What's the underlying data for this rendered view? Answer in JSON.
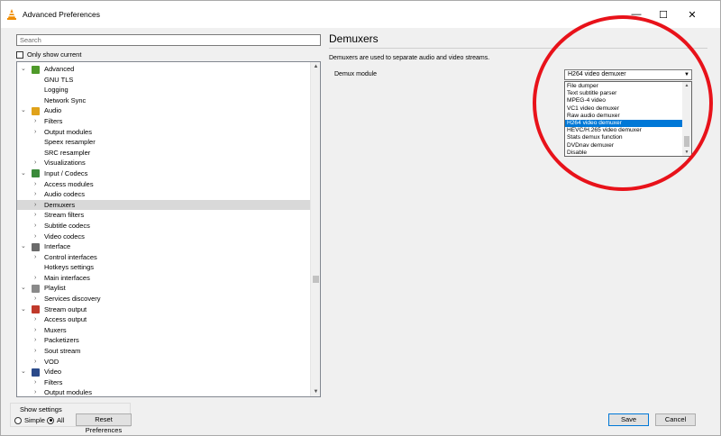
{
  "window": {
    "title": "Advanced Preferences",
    "controls": {
      "minimize": "—",
      "maximize": "☐",
      "close": "✕"
    }
  },
  "left": {
    "search_placeholder": "Search",
    "only_show_current": "Only show current",
    "tree": [
      {
        "label": "Advanced",
        "level": 0,
        "expanded": true,
        "icon": "advanced-icon",
        "color": "#4f9a2a"
      },
      {
        "label": "GNU TLS",
        "level": 1
      },
      {
        "label": "Logging",
        "level": 1
      },
      {
        "label": "Network Sync",
        "level": 1
      },
      {
        "label": "Audio",
        "level": 0,
        "expanded": true,
        "icon": "music-note-icon",
        "color": "#e0a21a"
      },
      {
        "label": "Filters",
        "level": 1,
        "arrow": true
      },
      {
        "label": "Output modules",
        "level": 1,
        "arrow": true
      },
      {
        "label": "Speex resampler",
        "level": 1
      },
      {
        "label": "SRC resampler",
        "level": 1
      },
      {
        "label": "Visualizations",
        "level": 1,
        "arrow": true
      },
      {
        "label": "Input / Codecs",
        "level": 0,
        "expanded": true,
        "icon": "input-codecs-icon",
        "color": "#3a8a3a"
      },
      {
        "label": "Access modules",
        "level": 1,
        "arrow": true
      },
      {
        "label": "Audio codecs",
        "level": 1,
        "arrow": true
      },
      {
        "label": "Demuxers",
        "level": 1,
        "arrow": true,
        "selected": true
      },
      {
        "label": "Stream filters",
        "level": 1,
        "arrow": true
      },
      {
        "label": "Subtitle codecs",
        "level": 1,
        "arrow": true
      },
      {
        "label": "Video codecs",
        "level": 1,
        "arrow": true
      },
      {
        "label": "Interface",
        "level": 0,
        "expanded": true,
        "icon": "interface-icon",
        "color": "#6b6b6b"
      },
      {
        "label": "Control interfaces",
        "level": 1,
        "arrow": true
      },
      {
        "label": "Hotkeys settings",
        "level": 1
      },
      {
        "label": "Main interfaces",
        "level": 1,
        "arrow": true
      },
      {
        "label": "Playlist",
        "level": 0,
        "expanded": true,
        "icon": "playlist-icon",
        "color": "#8a8a8a"
      },
      {
        "label": "Services discovery",
        "level": 1,
        "arrow": true
      },
      {
        "label": "Stream output",
        "level": 0,
        "expanded": true,
        "icon": "stream-output-icon",
        "color": "#c0392b"
      },
      {
        "label": "Access output",
        "level": 1,
        "arrow": true
      },
      {
        "label": "Muxers",
        "level": 1,
        "arrow": true
      },
      {
        "label": "Packetizers",
        "level": 1,
        "arrow": true
      },
      {
        "label": "Sout stream",
        "level": 1,
        "arrow": true
      },
      {
        "label": "VOD",
        "level": 1,
        "arrow": true
      },
      {
        "label": "Video",
        "level": 0,
        "expanded": true,
        "icon": "video-icon",
        "color": "#2b4a8a"
      },
      {
        "label": "Filters",
        "level": 1,
        "arrow": true
      },
      {
        "label": "Output modules",
        "level": 1,
        "arrow": true
      }
    ],
    "show_settings": {
      "legend": "Show settings",
      "simple": "Simple",
      "all": "All",
      "selected": "All"
    },
    "reset_label": "Reset Preferences"
  },
  "right": {
    "title": "Demuxers",
    "description": "Demuxers are used to separate audio and video streams.",
    "demux_label": "Demux module",
    "combo_value": "H264 video demuxer",
    "dropdown_options": [
      "File dumper",
      "Text subtitle parser",
      "MPEG-4 video",
      "VC1 video demuxer",
      "Raw audio demuxer",
      "H264 video demuxer",
      "HEVC/H.265 video demuxer",
      "Stats demux function",
      "DVDnav demuxer",
      "Disable"
    ],
    "highlighted_option": "H264 video demuxer",
    "annotation_color": "#e8121a"
  },
  "buttons": {
    "save": "Save",
    "cancel": "Cancel"
  }
}
